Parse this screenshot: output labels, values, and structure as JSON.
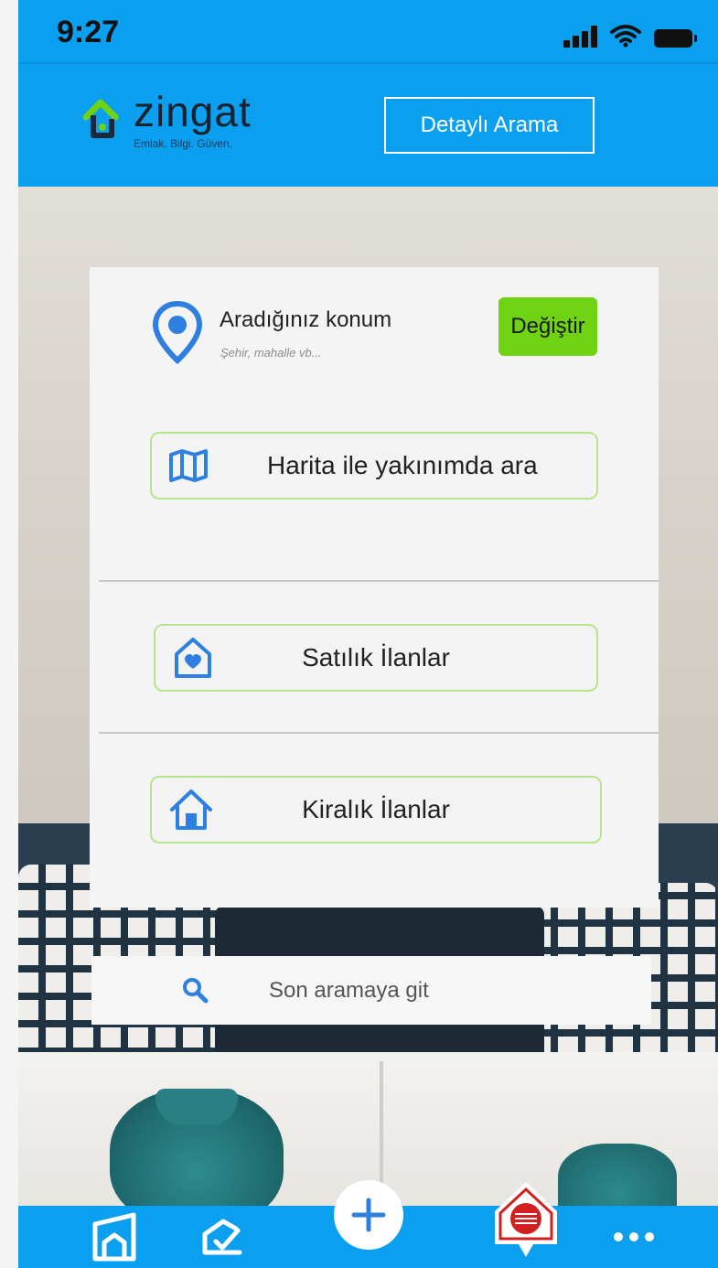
{
  "status_bar": {
    "time": "9:27"
  },
  "header": {
    "logo_text": "zingat",
    "logo_tagline": "Emlak. Bilgi. Güven.",
    "detail_search_label": "Detaylı Arama"
  },
  "location": {
    "title": "Aradığınız konum",
    "subtitle": "Şehir, mahalle vb...",
    "change_label": "Değiştir"
  },
  "options": {
    "map_search_label": "Harita ile yakınımda ara",
    "for_sale_label": "Satılık İlanlar",
    "for_rent_label": "Kiralık İlanlar"
  },
  "last_search": {
    "label": "Son aramaya git"
  },
  "bottom_nav": {
    "items": [
      {
        "icon": "home-icon"
      },
      {
        "icon": "checklist-icon"
      },
      {
        "icon": "plus-icon"
      },
      {
        "icon": "zingat-badge-icon"
      },
      {
        "icon": "more-icon"
      }
    ]
  },
  "colors": {
    "primary_blue": "#0b9ff0",
    "accent_green": "#6fd314",
    "option_border": "#b7e58c",
    "icon_blue": "#2d7fe0"
  }
}
